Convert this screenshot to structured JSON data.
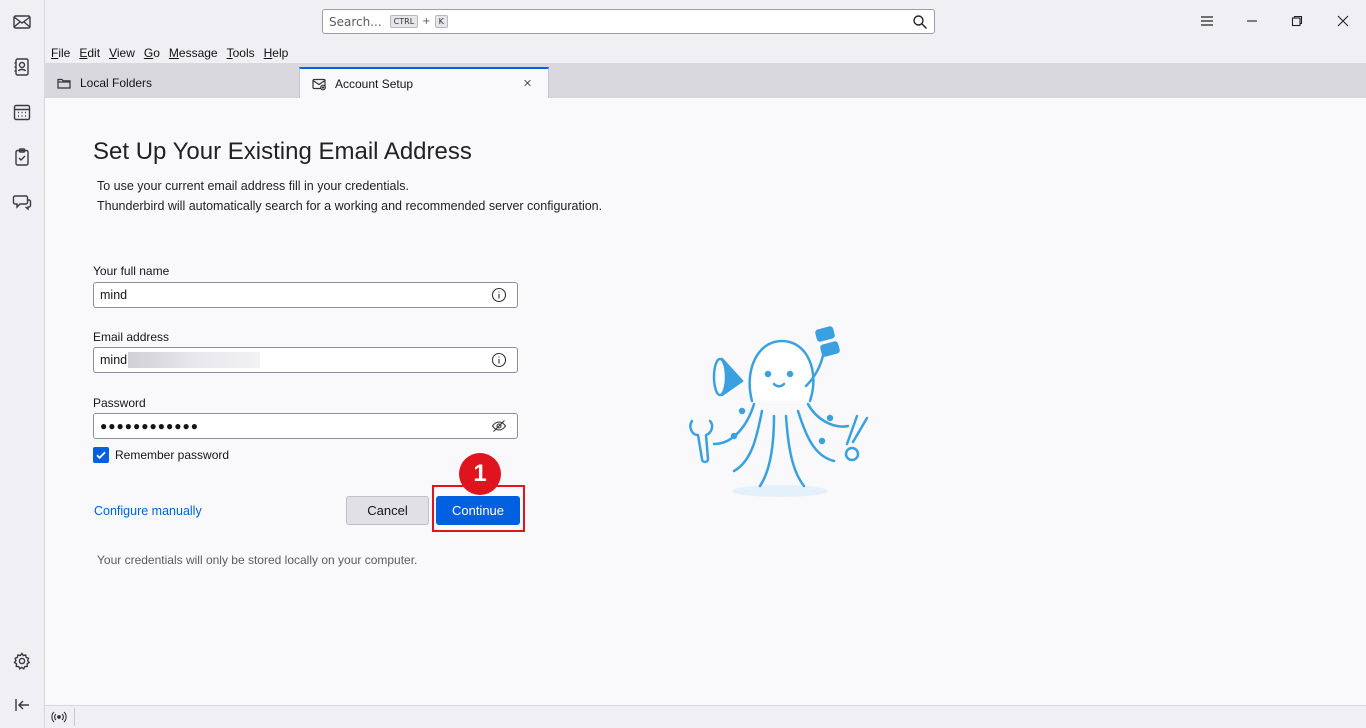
{
  "window": {
    "search_placeholder": "Search...",
    "search_kbd_mod": "CTRL",
    "search_kbd_plus": "+",
    "search_kbd_key": "K"
  },
  "spaces": [
    "mail-icon",
    "address-book-icon",
    "calendar-icon",
    "tasks-icon",
    "chat-icon",
    "settings-icon",
    "collapse-icon"
  ],
  "menubar": [
    "File",
    "Edit",
    "View",
    "Go",
    "Message",
    "Tools",
    "Help"
  ],
  "tabs": [
    {
      "label": "Local Folders",
      "icon": "folder-icon"
    },
    {
      "label": "Account Setup",
      "icon": "account-setup-icon",
      "active": true
    }
  ],
  "setup": {
    "title": "Set Up Your Existing Email Address",
    "desc_line1": "To use your current email address fill in your credentials.",
    "desc_line2": "Thunderbird will automatically search for a working and recommended server configuration.",
    "name_label": "Your full name",
    "name_value": "mind",
    "email_label": "Email address",
    "email_value": "mind",
    "password_label": "Password",
    "password_value": "●●●●●●●●●●●●",
    "remember_label": "Remember password",
    "remember_checked": true,
    "configure_link": "Configure manually",
    "cancel_label": "Cancel",
    "continue_label": "Continue",
    "footer_note": "Your credentials will only be stored locally on your computer."
  },
  "annotation": {
    "step_number": "1",
    "color": "#e0141e"
  },
  "colors": {
    "accent": "#0061e0",
    "mascot": "#3aa0e0"
  }
}
